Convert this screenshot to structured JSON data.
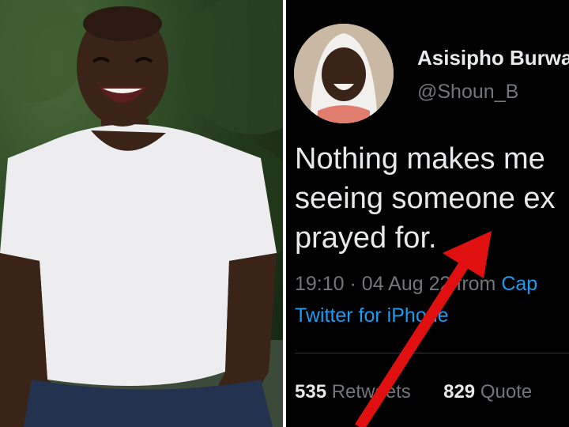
{
  "tweet": {
    "display_name": "Asisipho Burwa",
    "handle": "@Shoun_B",
    "text_lines": [
      "Nothing makes me",
      "seeing someone ex",
      "prayed for."
    ],
    "time": "19:10",
    "date": "04 Aug 22",
    "from_label": "from",
    "location": "Cap",
    "source": "Twitter for iPhone",
    "retweets_count": "535",
    "retweets_label": "Retweets",
    "quotes_count": "829",
    "quotes_label": "Quote"
  },
  "colors": {
    "background": "#000000",
    "text": "#e7e9ea",
    "muted": "#71767b",
    "link": "#1d9bf0",
    "arrow": "#e01010"
  }
}
